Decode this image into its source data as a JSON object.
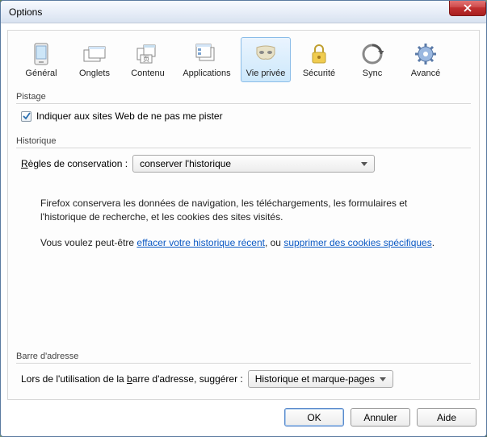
{
  "window": {
    "title": "Options"
  },
  "tabs": {
    "general": "Général",
    "onglets": "Onglets",
    "contenu": "Contenu",
    "applications": "Applications",
    "vieprivee": "Vie privée",
    "securite": "Sécurité",
    "sync": "Sync",
    "avance": "Avancé",
    "active": "vieprivee"
  },
  "pistage": {
    "legend": "Pistage",
    "checkbox_label": "Indiquer aux sites Web de ne pas me pister",
    "checked": true
  },
  "historique": {
    "legend": "Historique",
    "rules_label_prefix": "Règles de conservation :",
    "rules_prefix_u": "R",
    "rules_select_value": "conserver l'historique",
    "info1": "Firefox conservera les données de navigation, les téléchargements, les formulaires et l'historique de recherche, et les cookies des sites visités.",
    "info2_prefix": "Vous voulez peut-être ",
    "info2_link1": "effacer votre historique récent",
    "info2_sep": ", ou ",
    "info2_link2": "supprimer des cookies spécifiques",
    "info2_suffix": "."
  },
  "barre": {
    "legend": "Barre d'adresse",
    "label_prefix": "Lors de l'utilisation de la ",
    "label_u": "b",
    "label_rest": "arre d'adresse, suggérer :",
    "select_value": "Historique et marque-pages"
  },
  "buttons": {
    "ok": "OK",
    "cancel": "Annuler",
    "help": "Aide"
  }
}
